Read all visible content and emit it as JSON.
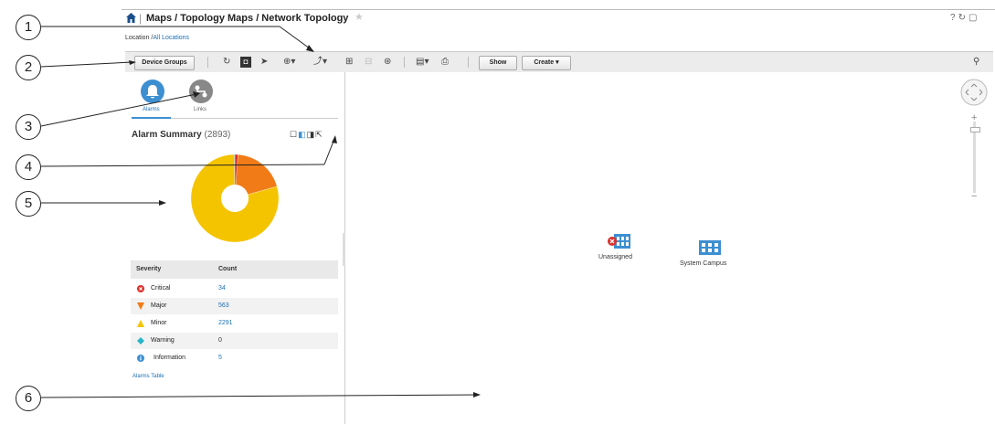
{
  "header": {
    "title": "Maps / Topology Maps / Network Topology",
    "location_prefix": "Location /",
    "location_link": "All Locations"
  },
  "toolbar": {
    "device_groups_label": "Device Groups",
    "show_label": "Show",
    "create_label": "Create"
  },
  "tabs": [
    {
      "label": "Alarms"
    },
    {
      "label": "Links"
    }
  ],
  "alarm_summary": {
    "title": "Alarm Summary",
    "total": "(2893)"
  },
  "severity_table": {
    "headers": [
      "Severity",
      "Count"
    ],
    "rows": [
      {
        "severity": "Critical",
        "count": "34",
        "color": "#d9302c"
      },
      {
        "severity": "Major",
        "count": "563",
        "color": "#f07b17"
      },
      {
        "severity": "Minor",
        "count": "2291",
        "color": "#f5c400"
      },
      {
        "severity": "Warning",
        "count": "0",
        "color": "#29b6c8"
      },
      {
        "severity": "Information",
        "count": "5",
        "color": "#3d8fd1"
      }
    ],
    "link": "Alarms Table"
  },
  "map": {
    "nodes": [
      {
        "label": "Unassigned",
        "icon": "building-icon-unassigned"
      },
      {
        "label": "System Campus",
        "icon": "building-icon"
      }
    ]
  },
  "callouts": [
    "1",
    "2",
    "3",
    "4",
    "5",
    "6"
  ],
  "colors": {
    "accent": "#3d8fd1",
    "critical": "#d9302c",
    "major": "#f07b17",
    "minor": "#f5c400"
  }
}
